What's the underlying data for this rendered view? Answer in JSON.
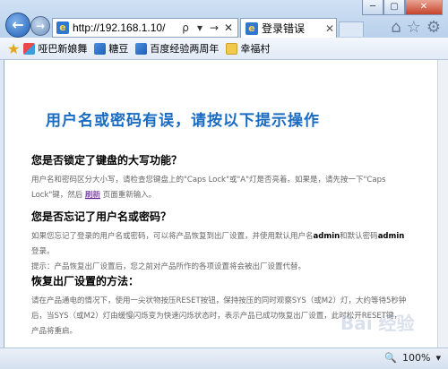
{
  "window": {
    "min_symbol": "─",
    "max_symbol": "▢",
    "close_symbol": "✕"
  },
  "nav": {
    "back_symbol": "←",
    "forward_symbol": "→"
  },
  "address": {
    "url": "http://192.168.1.10/",
    "search_symbol": "ρ",
    "dropdown_symbol": "▾",
    "go_symbol": "→",
    "stop_symbol": "✕"
  },
  "tab": {
    "title": "登录错误",
    "close_symbol": "✕"
  },
  "toolbar": {
    "home_icon": "⌂",
    "favorites_icon": "☆",
    "tools_icon": "⚙"
  },
  "favorites": {
    "items": [
      {
        "label": "哑巴新娘舞"
      },
      {
        "label": "糖豆"
      },
      {
        "label": "百度经验两周年"
      },
      {
        "label": "幸福村"
      }
    ]
  },
  "page": {
    "title": "用户名或密码有误，请按以下提示操作",
    "sections": [
      {
        "heading": "您是否锁定了键盘的大写功能？",
        "text_a": "用户名和密码区分大小写，请检查您键盘上的\"Caps Lock\"或\"A\"灯是否亮着。如果是，请先按一下\"Caps Lock\"键，然后",
        "link": "刷新",
        "text_b": "页面重新输入。"
      },
      {
        "heading": "您是否忘记了用户名或密码？",
        "text_a": "如果您忘记了登录的用户名或密码，可以将产品恢复到出厂设置，并使用默认用户名",
        "bold_a": "admin",
        "text_b": "和默认密码",
        "bold_b": "admin",
        "text_c": "登录。",
        "tip": "提示：产品恢复出厂设置后，您之前对产品所作的各项设置将会被出厂设置代替。"
      },
      {
        "heading": "恢复出厂设置的方法：",
        "text": "请在产品通电的情况下，使用一尖状物按压RESET按钮，保持按压的同时观察SYS（或M2）灯，大约等待5秒钟后，当SYS（或M2）灯由缓慢闪烁变为快速闪烁状态时，表示产品已成功恢复出厂设置，此时松开RESET键，产品将重启。"
      }
    ]
  },
  "status": {
    "zoom": "100%",
    "zoom_dropdown": "▾"
  },
  "watermark": "Bai 经验"
}
